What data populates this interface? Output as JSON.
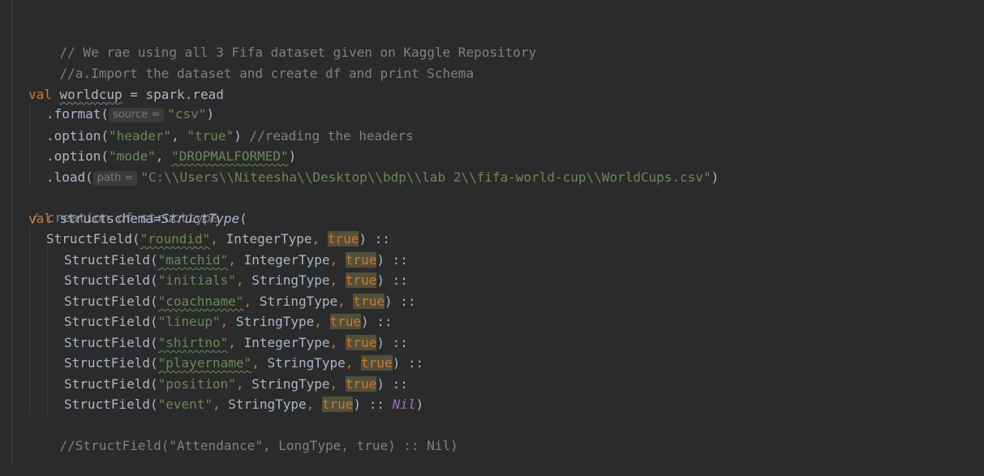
{
  "editor": {
    "lines": {
      "l1": "// We rae using all 3 Fifa dataset given on Kaggle Repository",
      "l2": "//a.Import the dataset and create df and print Schema",
      "l3a": "val",
      "l3b": "worldcup",
      "l3c": " = spark.read",
      "l4a": ".format(",
      "l4hint": "source =",
      "l4b": "\"csv\"",
      "l4c": ")",
      "l5a": ".option(",
      "l5b": "\"header\"",
      "l5c": ", ",
      "l5d": "\"true\"",
      "l5e": ") ",
      "l5f": "//reading the headers",
      "l6a": ".option(",
      "l6b": "\"mode\"",
      "l6c": ", ",
      "l6d": "\"DROPMALFORMED\"",
      "l6e": ")",
      "l7a": ".load(",
      "l7hint": "path =",
      "l7b": "\"C:\\\\Users\\\\Niteesha\\\\Desktop\\\\bdp\\\\lab 2\\\\fifa-world-cup\\\\WorldCups.csv\"",
      "l7c": ")",
      "l8": "/ creation of structtype",
      "l9a": "val",
      "l9b": " structschema=",
      "l9c": "StructType",
      "l9d": "(",
      "fields": [
        {
          "name": "\"roundid\"",
          "type": "IntegerType",
          "flag": "true",
          "tail": ") ::"
        },
        {
          "name": "\"matchid\"",
          "type": "IntegerType",
          "flag": "true",
          "tail": ") ::"
        },
        {
          "name": "\"initials\"",
          "type": "StringType",
          "flag": "true",
          "tail": ") ::"
        },
        {
          "name": "\"coachname\"",
          "type": "StringType",
          "flag": "true",
          "tail": ") ::"
        },
        {
          "name": "\"lineup\"",
          "type": "StringType",
          "flag": "true",
          "tail": ") ::"
        },
        {
          "name": "\"shirtno\"",
          "type": "IntegerType",
          "flag": "true",
          "tail": ") ::"
        },
        {
          "name": "\"playername\"",
          "type": "StringType",
          "flag": "true",
          "tail": ") ::"
        },
        {
          "name": "\"position\"",
          "type": "StringType",
          "flag": "true",
          "tail": ") ::"
        },
        {
          "name": "\"event\"",
          "type": "StringType",
          "flag": "true",
          "tail": ") :: ",
          "nil": "Nil",
          "close": ")"
        }
      ],
      "structfield": "StructField(",
      "sep": ", ",
      "l19": "//StructField(\"Attendance\", LongType, true) :: Nil)"
    }
  },
  "colors": {
    "background": "#2b2b2b",
    "keyword": "#cc7832",
    "string": "#6a8759",
    "comment": "#808080",
    "text": "#a9b7c6",
    "nil": "#9876aa",
    "highlight": "#52503a"
  }
}
